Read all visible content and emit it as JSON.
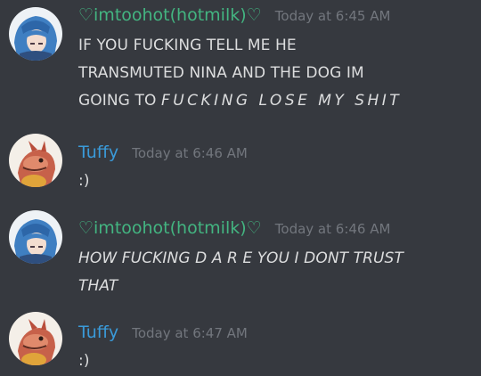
{
  "colors": {
    "background": "#36393f",
    "message_text": "#dcddde",
    "timestamp": "#72767d",
    "user_hotmilk": "#43b581",
    "user_tuffy": "#3a9ad9"
  },
  "messages": [
    {
      "username": "♡imtoohot(hotmilk)♡",
      "timestamp": "Today at 6:45 AM",
      "avatar_icon": "anime-girl-avatar-icon",
      "text_line1": "IF YOU FUCKING TELL ME HE",
      "text_line2": "TRANSMUTED NINA AND THE DOG IM",
      "text_line3_prefix": "GOING TO ",
      "text_line3_emphasis": "FUCKING LOSE MY SHIT"
    },
    {
      "username": "Tuffy",
      "timestamp": "Today at 6:46 AM",
      "avatar_icon": "dragon-avatar-icon",
      "text": ":)"
    },
    {
      "username": "♡imtoohot(hotmilk)♡",
      "timestamp": "Today at 6:46 AM",
      "avatar_icon": "anime-girl-avatar-icon",
      "text_line1": "HOW FUCKING D A R E YOU I DONT TRUST",
      "text_line2": "THAT"
    },
    {
      "username": "Tuffy",
      "timestamp": "Today at 6:47 AM",
      "avatar_icon": "dragon-avatar-icon",
      "text": ":)"
    }
  ]
}
